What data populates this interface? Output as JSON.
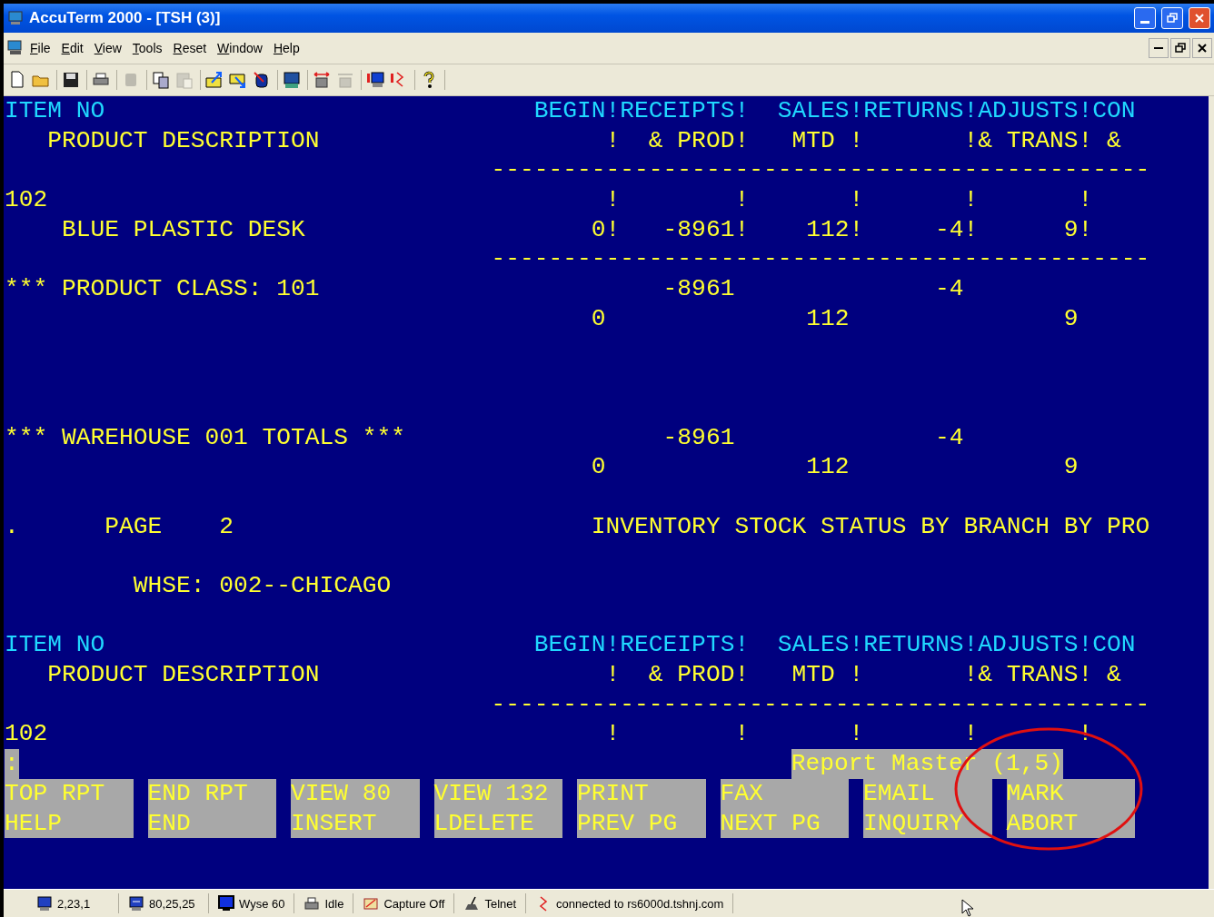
{
  "window": {
    "title": "AccuTerm 2000 - [TSH (3)]"
  },
  "menu": [
    {
      "label": "File"
    },
    {
      "label": "Edit"
    },
    {
      "label": "View"
    },
    {
      "label": "Tools"
    },
    {
      "label": "Reset"
    },
    {
      "label": "Window"
    },
    {
      "label": "Help"
    }
  ],
  "toolbar": [
    [
      {
        "disabled": false
      },
      {
        "disabled": false
      }
    ],
    [
      {
        "disabled": false
      }
    ],
    [
      {
        "disabled": false
      }
    ],
    [
      {
        "disabled": true
      }
    ],
    [
      {
        "disabled": false
      },
      {
        "disabled": true
      }
    ],
    [
      {
        "disabled": false
      },
      {
        "disabled": false
      },
      {
        "disabled": false
      }
    ],
    [
      {
        "disabled": false
      }
    ],
    [
      {
        "disabled": false
      },
      {
        "disabled": true
      }
    ],
    [
      {
        "disabled": false
      },
      {
        "disabled": false
      }
    ],
    [
      {
        "disabled": false
      }
    ]
  ],
  "screen_lines": [
    {
      "kind": "header",
      "text": "ITEM NO                              BEGIN!RECEIPTS!  SALES!RETURNS!ADJUSTS!CON"
    },
    {
      "kind": "text",
      "text": "   PRODUCT DESCRIPTION                    !  & PROD!   MTD !       !& TRANS! &"
    },
    {
      "kind": "text",
      "text": "                                  ----------------------------------------------"
    },
    {
      "kind": "text",
      "text": "102                                       !        !       !       !       !"
    },
    {
      "kind": "text",
      "text": "    BLUE PLASTIC DESK                    0!   -8961!    112!     -4!      9!"
    },
    {
      "kind": "text",
      "text": "                                  ----------------------------------------------"
    },
    {
      "kind": "text",
      "text": "*** PRODUCT CLASS: 101                        -8961              -4"
    },
    {
      "kind": "text",
      "text": "                                         0              112               9"
    },
    {
      "kind": "blank"
    },
    {
      "kind": "blank"
    },
    {
      "kind": "blank"
    },
    {
      "kind": "text",
      "text": "*** WAREHOUSE 001 TOTALS ***                  -8961              -4"
    },
    {
      "kind": "text",
      "text": "                                         0              112               9"
    },
    {
      "kind": "blank"
    },
    {
      "kind": "text",
      "text": ".      PAGE    2                         INVENTORY STOCK STATUS BY BRANCH BY PRO"
    },
    {
      "kind": "blank"
    },
    {
      "kind": "text",
      "text": "         WHSE: 002--CHICAGO"
    },
    {
      "kind": "blank"
    },
    {
      "kind": "header",
      "text": "ITEM NO                              BEGIN!RECEIPTS!  SALES!RETURNS!ADJUSTS!CON"
    },
    {
      "kind": "text",
      "text": "   PRODUCT DESCRIPTION                    !  & PROD!   MTD !       !& TRANS! &"
    },
    {
      "kind": "text",
      "text": "                                  ----------------------------------------------"
    },
    {
      "kind": "text",
      "text": "102                                       !        !       !       !       !"
    }
  ],
  "prompt_line": {
    "prompt": ":",
    "message": "Report Master (1,5)"
  },
  "function_keys": [
    {
      "top": "TOP RPT",
      "bottom": "HELP"
    },
    {
      "top": "END RPT",
      "bottom": "END"
    },
    {
      "top": "VIEW 80",
      "bottom": "INSERT"
    },
    {
      "top": "VIEW 132",
      "bottom": "LDELETE"
    },
    {
      "top": "PRINT",
      "bottom": "PREV PG"
    },
    {
      "top": "FAX",
      "bottom": "NEXT PG"
    },
    {
      "top": "EMAIL",
      "bottom": "INQUIRY"
    },
    {
      "top": "MARK",
      "bottom": "ABORT"
    }
  ],
  "annotations": [
    {
      "kind": "ellipse"
    }
  ],
  "status_bar": [
    {
      "kind": "cursor",
      "text": "2,23,1"
    },
    {
      "kind": "size",
      "text": "80,25,25"
    },
    {
      "kind": "terminal",
      "text": "Wyse 60"
    },
    {
      "kind": "printer",
      "text": "Idle"
    },
    {
      "kind": "capture",
      "text": "Capture Off"
    },
    {
      "kind": "telnet",
      "text": "Telnet"
    },
    {
      "kind": "connection",
      "text": "connected to rs6000d.tshnj.com"
    }
  ]
}
